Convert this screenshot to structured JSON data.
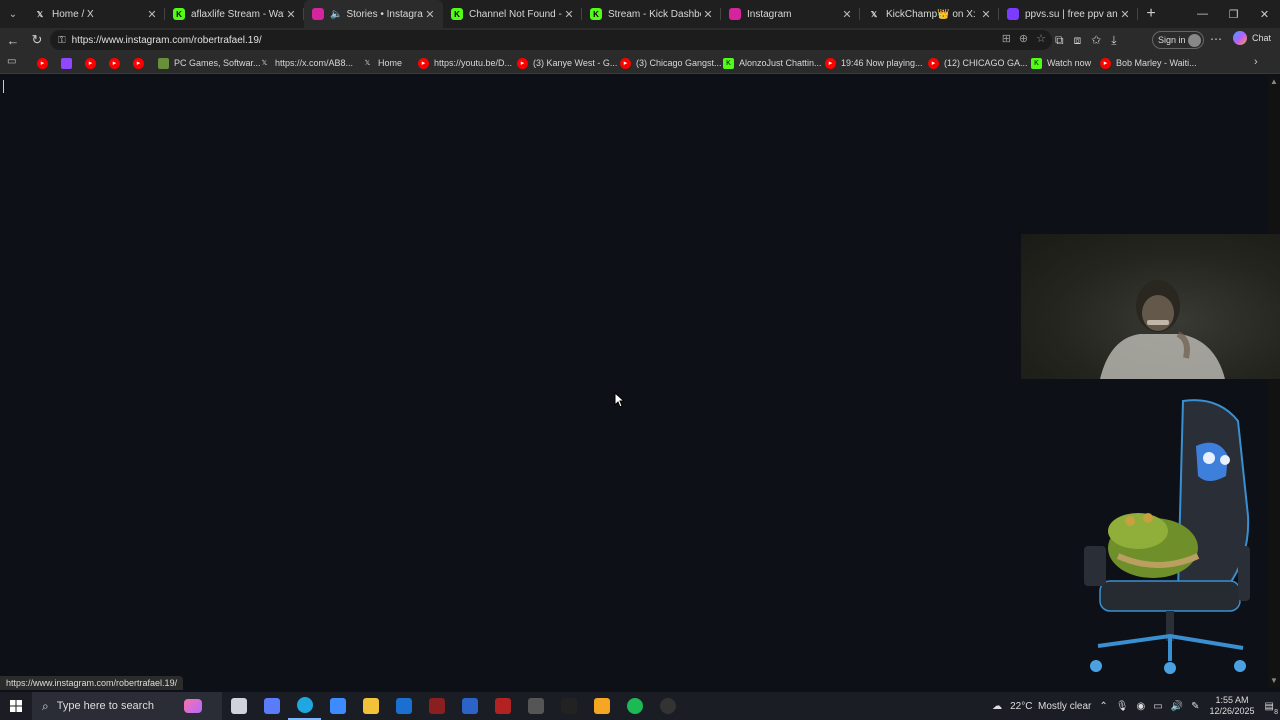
{
  "tabs": [
    {
      "title": "Home / X",
      "icon": "x-logo-icon",
      "color": "#1f1f1f",
      "active": false
    },
    {
      "title": "aflaxlife Stream - Watch Live",
      "icon": "kick-logo-icon",
      "color": "#53fc18",
      "active": false
    },
    {
      "title": "Stories • Instagram",
      "icon": "instagram-icon",
      "color": "#d6249f",
      "active": true
    },
    {
      "title": "Channel Not Found - Kick St",
      "icon": "kick-logo-icon",
      "color": "#53fc18",
      "active": false
    },
    {
      "title": "Stream - Kick Dashboard",
      "icon": "kick-logo-icon",
      "color": "#53fc18",
      "active": false
    },
    {
      "title": "Instagram",
      "icon": "instagram-icon",
      "color": "#d6249f",
      "active": false
    },
    {
      "title": "KickChamp👑 on X: \"Clavicu",
      "icon": "x-logo-icon",
      "color": "#1f1f1f",
      "active": false
    },
    {
      "title": "ppvs.su | free ppv and sports",
      "icon": "ppvs-icon",
      "color": "#7a3cff",
      "active": false
    }
  ],
  "address": {
    "url": "https://www.instagram.com/robertrafael.19/"
  },
  "toolbar": {
    "signin_label": "Sign in",
    "chat_label": "Chat"
  },
  "bookmarks": [
    {
      "label": "",
      "icon": "youtube-icon",
      "color": "#ff0000"
    },
    {
      "label": "",
      "icon": "twitch-icon",
      "color": "#9146ff"
    },
    {
      "label": "",
      "icon": "youtube-icon",
      "color": "#ff0000"
    },
    {
      "label": "",
      "icon": "youtube-icon",
      "color": "#ff0000"
    },
    {
      "label": "",
      "icon": "youtube-icon",
      "color": "#ff0000"
    },
    {
      "label": "PC Games, Softwar...",
      "icon": "pc-games-icon",
      "color": "#6a8f3a"
    },
    {
      "label": "https://x.com/AB8...",
      "icon": "x-logo-icon",
      "color": "#000000"
    },
    {
      "label": "Home",
      "icon": "x-logo-icon",
      "color": "#000000"
    },
    {
      "label": "https://youtu.be/D...",
      "icon": "youtube-icon",
      "color": "#ff0000"
    },
    {
      "label": "(3) Kanye West - G...",
      "icon": "youtube-icon",
      "color": "#ff0000"
    },
    {
      "label": "(3) Chicago Gangst...",
      "icon": "youtube-icon",
      "color": "#ff0000"
    },
    {
      "label": "AlonzoJust Chattin...",
      "icon": "kick-logo-icon",
      "color": "#53fc18"
    },
    {
      "label": "19:46 Now playing...",
      "icon": "youtube-icon",
      "color": "#ff0000"
    },
    {
      "label": "(12) CHICAGO GA...",
      "icon": "youtube-icon",
      "color": "#ff0000"
    },
    {
      "label": "Watch now",
      "icon": "kick-logo-icon",
      "color": "#53fc18"
    },
    {
      "label": "Bob Marley - Waiti...",
      "icon": "youtube-icon",
      "color": "#ff0000"
    }
  ],
  "status": {
    "link": "https://www.instagram.com/robertrafael.19/"
  },
  "taskbar": {
    "search_placeholder": "Type here to search",
    "apps": [
      {
        "icon": "task-view-icon",
        "color": "#cfd3dc"
      },
      {
        "icon": "copilot-icon",
        "color": "#5b7cfa"
      },
      {
        "icon": "edge-icon",
        "color": "#1fa7e0",
        "active": true
      },
      {
        "icon": "store-icon",
        "color": "#3d8bff"
      },
      {
        "icon": "file-explorer-icon",
        "color": "#f3c23b"
      },
      {
        "icon": "outlook-icon",
        "color": "#1b6fd1"
      },
      {
        "icon": "app-red-icon",
        "color": "#8a1f1f"
      },
      {
        "icon": "fatal-app-icon",
        "color": "#2b63c9"
      },
      {
        "icon": "mega-icon",
        "color": "#b22222"
      },
      {
        "icon": "character-app-icon",
        "color": "#555555"
      },
      {
        "icon": "dark-app-icon",
        "color": "#222222"
      },
      {
        "icon": "bolt-app-icon",
        "color": "#f5a623"
      },
      {
        "icon": "spotify-icon",
        "color": "#1db954"
      },
      {
        "icon": "obs-icon",
        "color": "#333333"
      }
    ],
    "weather": "22°C  Mostly clear",
    "time": "1:55 AM",
    "date": "12/26/2025",
    "notification_count": "8"
  }
}
